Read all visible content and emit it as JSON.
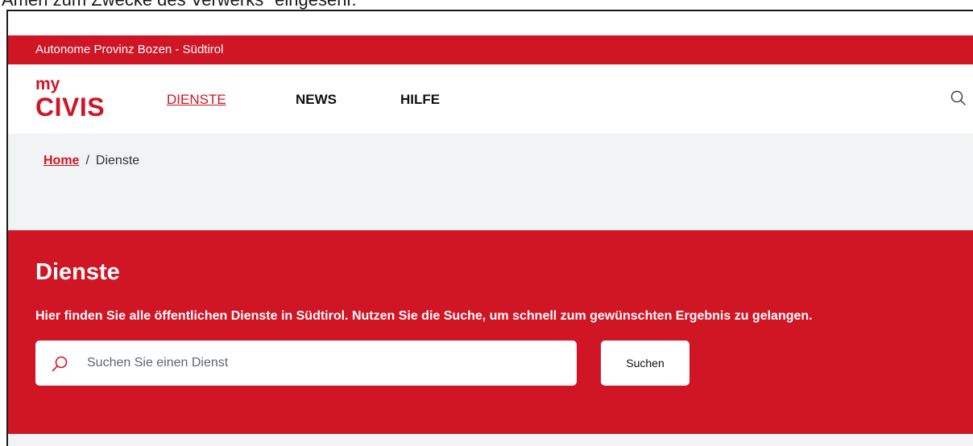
{
  "caption": "Amen zum Zwecke des Verwerks\" eingesehr.",
  "province_bar": {
    "text": "Autonome Provinz Bozen - Südtirol"
  },
  "logo": {
    "line1": "my",
    "line2": "CIVIS"
  },
  "nav": [
    {
      "label": "DIENSTE",
      "active": true
    },
    {
      "label": "NEWS",
      "active": false
    },
    {
      "label": "HILFE",
      "active": false
    }
  ],
  "breadcrumb": {
    "home": "Home",
    "separator": "/",
    "current": "Dienste"
  },
  "hero": {
    "title": "Dienste",
    "subtitle": "Hier finden Sie alle öffentlichen Dienste in Südtirol. Nutzen Sie die Suche, um schnell zum gewünschten Ergebnis zu gelangen.",
    "search_placeholder": "Suchen Sie einen Dienst",
    "search_button": "Suchen"
  },
  "colors": {
    "brand_red": "#d01525",
    "light_gray": "#f2f3f4"
  },
  "icons": {
    "header_search": "search-icon",
    "input_search": "search-icon"
  }
}
